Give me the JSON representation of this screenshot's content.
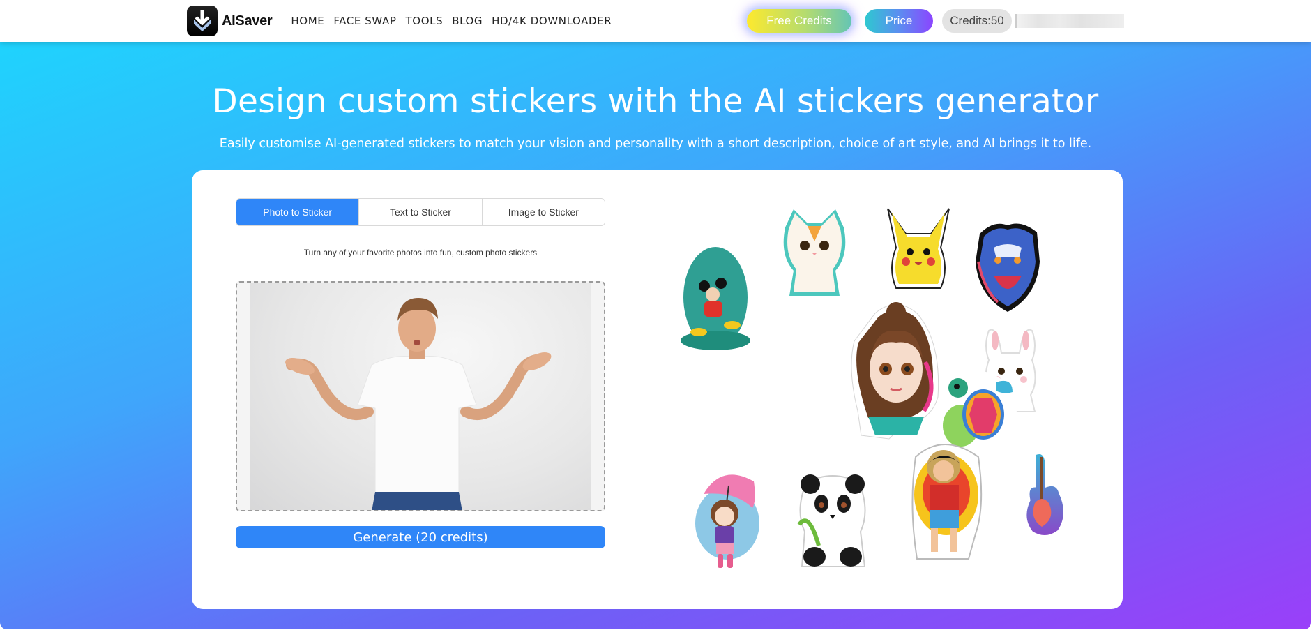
{
  "header": {
    "brand": "AISaver",
    "nav": [
      {
        "label": "HOME"
      },
      {
        "label": "FACE SWAP"
      },
      {
        "label": "TOOLS"
      },
      {
        "label": "BLOG"
      },
      {
        "label": "HD/4K DOWNLOADER"
      }
    ],
    "free_credits_label": "Free Credits",
    "price_label": "Price",
    "credits_label": "Credits:50",
    "icons": {
      "logo": "download-arrow-icon"
    }
  },
  "hero": {
    "title": "Design custom stickers with the AI stickers generator",
    "subtitle": "Easily customise AI-generated stickers to match your vision and personality with a short description, choice of art style, and AI brings it to life."
  },
  "generator": {
    "tabs": [
      {
        "label": "Photo to Sticker",
        "active": true
      },
      {
        "label": "Text to Sticker",
        "active": false
      },
      {
        "label": "Image to Sticker",
        "active": false
      }
    ],
    "description": "Turn any of your favorite photos into fun, custom photo stickers",
    "uploaded_image": "man in white t-shirt shrugging",
    "generate_label": "Generate (20 credits)"
  },
  "showcase": {
    "stickers": [
      {
        "name": "mouse-forest-sticker"
      },
      {
        "name": "kitten-sticker"
      },
      {
        "name": "yellow-electric-creature-sticker"
      },
      {
        "name": "angry-dog-sticker"
      },
      {
        "name": "girl-portrait-sticker"
      },
      {
        "name": "bunny-sticker"
      },
      {
        "name": "sea-turtle-sticker"
      },
      {
        "name": "umbrella-girl-sticker"
      },
      {
        "name": "panda-sticker"
      },
      {
        "name": "pirate-boy-sticker"
      },
      {
        "name": "guitar-sticker"
      }
    ]
  },
  "colors": {
    "primary": "#2f86f8",
    "gradient_start": "#1fd3fd",
    "gradient_end": "#9a3ff9"
  }
}
